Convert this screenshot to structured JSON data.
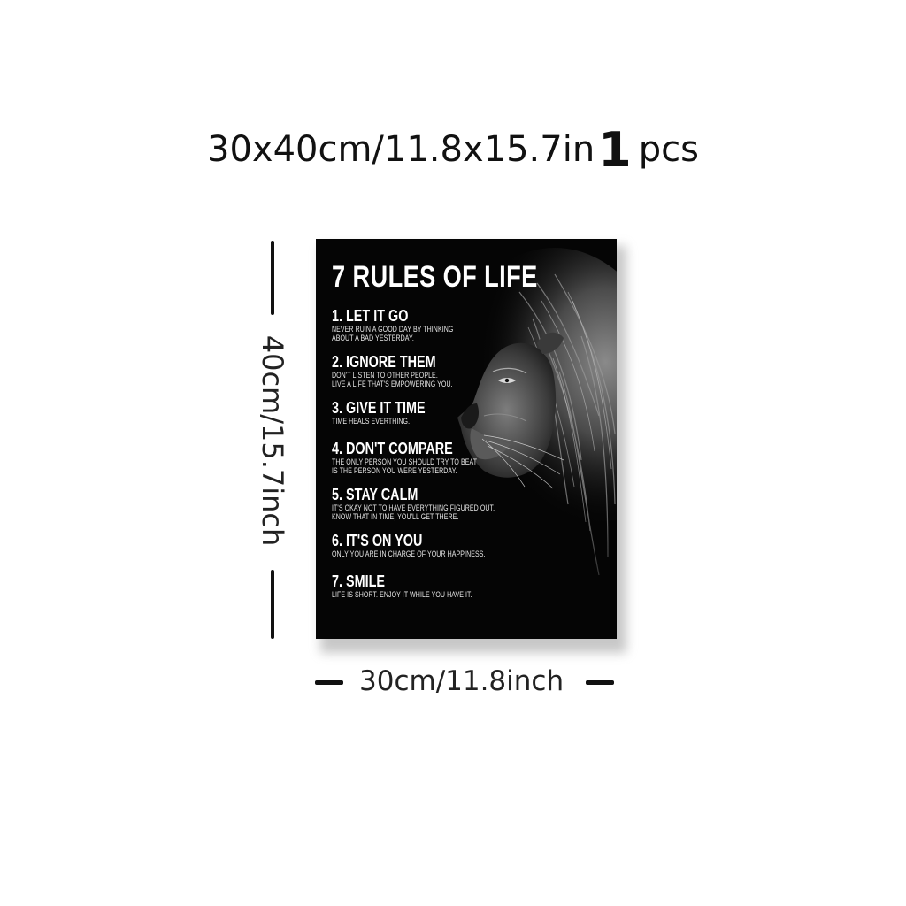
{
  "heading": {
    "size_text": "30x40cm/11.8x15.7in",
    "quantity": "1",
    "quantity_unit": "pcs"
  },
  "dimensions": {
    "height_label": "40cm/15.7inch",
    "width_label": "30cm/11.8inch"
  },
  "poster": {
    "title": "7 RULES OF LIFE",
    "background_color": "#050505",
    "image": "lion-profile-illustration",
    "rules": [
      {
        "title": "1. LET IT GO",
        "lines": [
          "NEVER RUIN A GOOD DAY BY THINKING",
          "ABOUT A BAD YESTERDAY."
        ]
      },
      {
        "title": "2. IGNORE THEM",
        "lines": [
          "DON'T LISTEN TO OTHER PEOPLE.",
          "LIVE A LIFE THAT'S EMPOWERING YOU."
        ]
      },
      {
        "title": "3. GIVE IT TIME",
        "lines": [
          "TIME HEALS EVERTHING."
        ]
      },
      {
        "title": "4. DON'T COMPARE",
        "lines": [
          "THE ONLY PERSON YOU SHOULD TRY TO BEAT",
          "IS THE PERSON YOU WERE YESTERDAY."
        ]
      },
      {
        "title": "5. STAY CALM",
        "lines": [
          "IT'S OKAY NOT TO HAVE EVERYTHING FIGURED OUT.",
          "KNOW THAT IN TIME, YOU'LL GET THERE."
        ]
      },
      {
        "title": "6. IT'S ON YOU",
        "lines": [
          "ONLY YOU ARE IN CHARGE OF YOUR HAPPINESS."
        ]
      },
      {
        "title": "7. SMILE",
        "lines": [
          "LIFE IS SHORT. ENJOY IT WHILE YOU HAVE IT."
        ]
      }
    ]
  }
}
